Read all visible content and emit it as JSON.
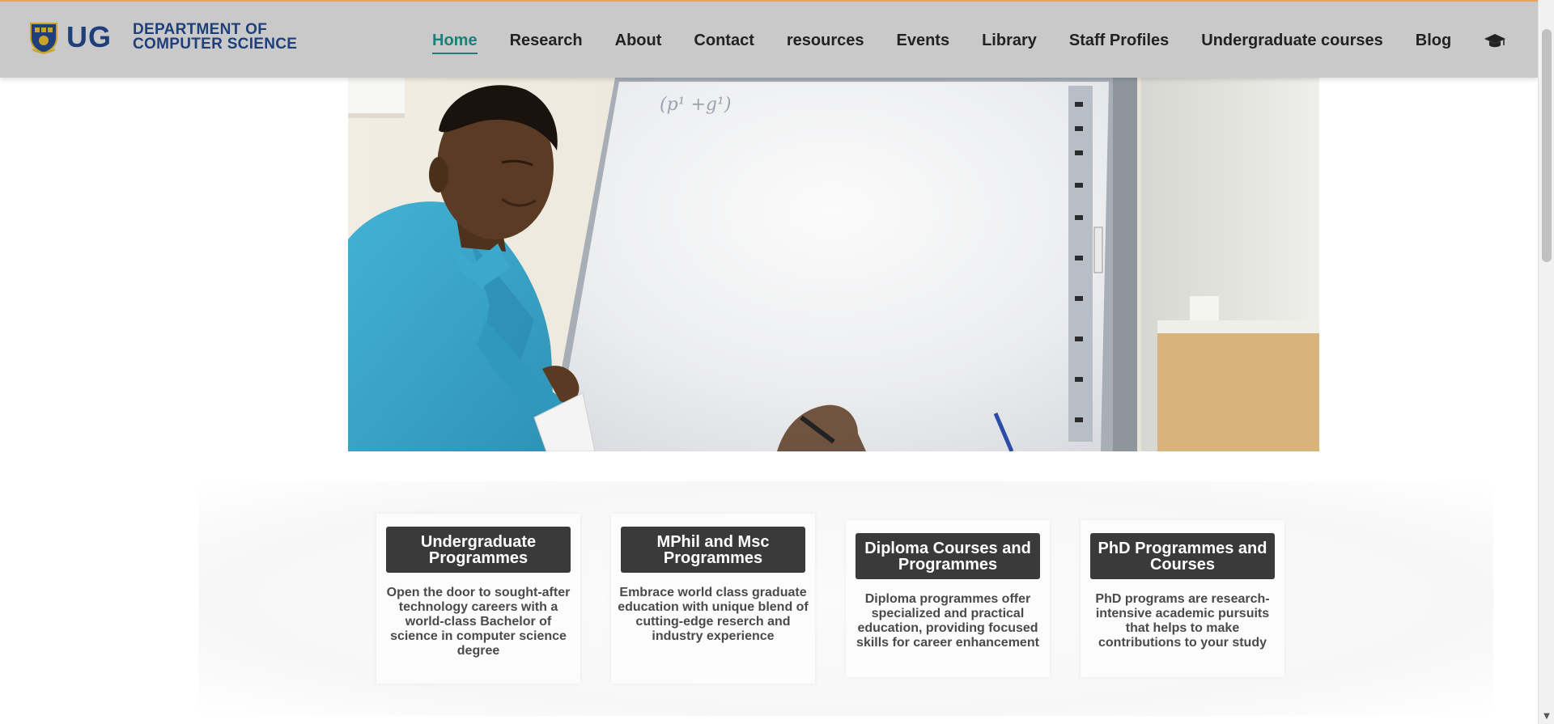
{
  "header": {
    "brand": {
      "short": "UG",
      "dept_line1": "DEPARTMENT OF",
      "dept_line2": "COMPUTER SCIENCE"
    },
    "nav": [
      {
        "label": "Home",
        "active": true
      },
      {
        "label": "Research"
      },
      {
        "label": "About"
      },
      {
        "label": "Contact"
      },
      {
        "label": "resources"
      },
      {
        "label": "Events"
      },
      {
        "label": "Library"
      },
      {
        "label": "Staff Profiles"
      },
      {
        "label": "Undergraduate courses"
      },
      {
        "label": "Blog"
      }
    ],
    "nav_icon": "graduation-cap-icon",
    "accent_color": "#1b7f7a",
    "brand_color": "#1f3f7a"
  },
  "hero": {
    "image": "lecturer-at-whiteboard-photo",
    "whiteboard_text": "(p¹ +g¹)"
  },
  "programmes": [
    {
      "title": "Undergraduate Programmes",
      "description": "Open the door to sought-after technology careers with a world-class Bachelor of science in computer science degree"
    },
    {
      "title": "MPhil and Msc Programmes",
      "description": "Embrace world class graduate education with unique blend of cutting-edge reserch and industry experience"
    },
    {
      "title": "Diploma Courses and Programmes",
      "description": "Diploma programmes offer specialized and practical education, providing focused skills for career enhancement"
    },
    {
      "title": "PhD Programmes and Courses",
      "description": "PhD programs are research-intensive academic pursuits that helps to make contributions to your study"
    }
  ]
}
